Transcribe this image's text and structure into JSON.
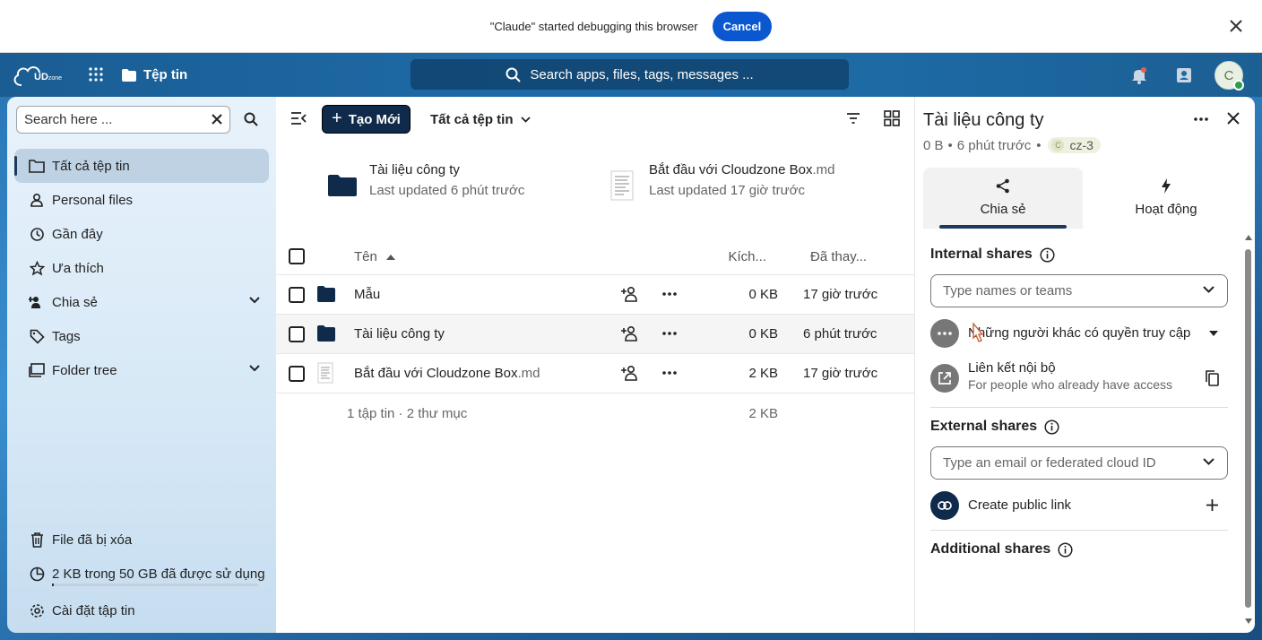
{
  "debug_bar": {
    "message": "\"Claude\" started debugging this browser",
    "cancel_label": "Cancel"
  },
  "header": {
    "logo_text": "UD",
    "logo_small": "zone",
    "app_name": "Tệp tin",
    "search_placeholder": "Search apps, files, tags, messages ...",
    "avatar_initial": "C"
  },
  "sidebar": {
    "search_placeholder": "Search here ...",
    "items": [
      {
        "label": "Tất cả tệp tin",
        "icon": "folder-icon",
        "active": true
      },
      {
        "label": "Personal files",
        "icon": "person-icon"
      },
      {
        "label": "Gần đây",
        "icon": "history-icon"
      },
      {
        "label": "Ưa thích",
        "icon": "star-icon"
      },
      {
        "label": "Chia sẻ",
        "icon": "share-icon",
        "expandable": true
      },
      {
        "label": "Tags",
        "icon": "tag-icon"
      },
      {
        "label": "Folder tree",
        "icon": "folder-tree-icon",
        "expandable": true
      }
    ],
    "bottom": {
      "deleted_label": "File đã bị xóa",
      "quota_label": "2 KB trong 50 GB đã được sử dụng",
      "quota_fraction": 0.01,
      "settings_label": "Cài đặt tập tin"
    }
  },
  "toolbar": {
    "new_label": "Tạo Mới",
    "view_label": "Tất cả tệp tin"
  },
  "recent": [
    {
      "name": "Tài liệu công ty",
      "ext": "",
      "updated": "Last updated 6 phút trước",
      "type": "folder"
    },
    {
      "name": "Bắt đầu với Cloudzone Box",
      "ext": ".md",
      "updated": "Last updated 17 giờ trước",
      "type": "document"
    }
  ],
  "table": {
    "headers": {
      "name": "Tên",
      "size": "Kích...",
      "modified": "Đã thay..."
    },
    "rows": [
      {
        "name": "Mẫu",
        "ext": "",
        "size": "0 KB",
        "modified": "17 giờ trước",
        "type": "folder"
      },
      {
        "name": "Tài liệu công ty",
        "ext": "",
        "size": "0 KB",
        "modified": "6 phút trước",
        "type": "folder"
      },
      {
        "name": "Bắt đầu với Cloudzone Box",
        "ext": ".md",
        "size": "2 KB",
        "modified": "17 giờ trước",
        "type": "document"
      }
    ],
    "summary_count": "1 tập tin · 2 thư mục",
    "summary_size": "2 KB"
  },
  "details": {
    "title": "Tài liệu công ty",
    "size": "0 B",
    "modified": "6 phút trước",
    "tag": "cz-3",
    "tag_initial": "C",
    "tabs": [
      {
        "label": "Chia sẻ",
        "icon": "share-nodes-icon",
        "active": true
      },
      {
        "label": "Hoạt động",
        "icon": "lightning-icon"
      }
    ],
    "internal_shares_title": "Internal shares",
    "internal_placeholder": "Type names or teams",
    "others_access_label": "Những người khác có quyền truy cập",
    "internal_link_label": "Liên kết nội bộ",
    "internal_link_sub": "For people who already have access",
    "external_shares_title": "External shares",
    "external_placeholder": "Type an email or federated cloud ID",
    "public_link_label": "Create public link",
    "additional_shares_title": "Additional shares"
  }
}
